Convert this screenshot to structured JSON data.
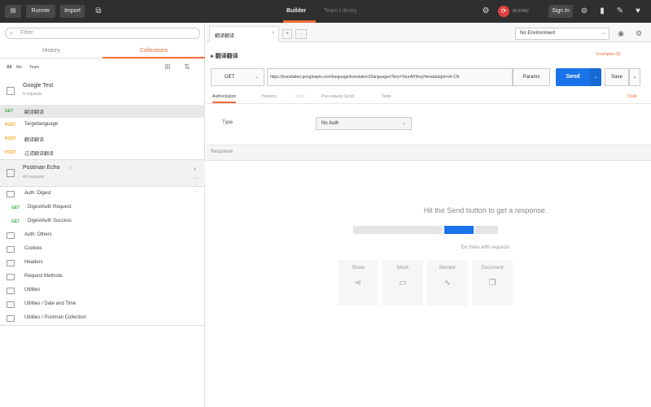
{
  "topbar": {
    "runner": "Runner",
    "import": "Import",
    "tab_builder": "Builder",
    "tab_team_library": "Team Library",
    "sync_status": "IN SYNC",
    "sign_in": "Sign In"
  },
  "sidebar": {
    "search_placeholder": "Filter",
    "tab_history": "History",
    "tab_collections": "Collections",
    "filter_all": "All",
    "filter_me": "Me",
    "filter_team": "Team",
    "collections": [
      {
        "name": "Google Test",
        "count": "4 requests",
        "items": [
          {
            "method": "GET",
            "label": "翻译翻译"
          },
          {
            "method": "POST",
            "label": "Targetlanguage"
          },
          {
            "method": "POST",
            "label": "翻译翻译"
          },
          {
            "method": "POST",
            "label": "过滤翻译翻译"
          }
        ]
      },
      {
        "name": "Postman Echo",
        "count": "40 requests",
        "items": []
      }
    ],
    "folders": [
      {
        "label": "Auth: Digest",
        "requests": [
          {
            "method": "GET",
            "label": "DigestAuth Request"
          },
          {
            "method": "GET",
            "label": "DigestAuth Success"
          }
        ]
      },
      {
        "label": "Auth: Others"
      },
      {
        "label": "Cookies"
      },
      {
        "label": "Headers"
      },
      {
        "label": "Request Methods"
      },
      {
        "label": "Utilities"
      },
      {
        "label": "Utilities / Date and Time"
      },
      {
        "label": "Utilities / Postman Collection"
      }
    ]
  },
  "main": {
    "tab_title": "翻译翻译",
    "environment": "No Environment",
    "request_name": "翻译翻译",
    "examples": "Examples (0)",
    "method": "GET",
    "url": "https://translation.googleapis.com/language/translate/v2/languages?key=YourAPIKeyHere&target=zh-CN",
    "params": "Params",
    "send": "Send",
    "save": "Save",
    "subtabs": [
      "Authorization",
      "Headers",
      "Body",
      "Pre-request Script",
      "Tests"
    ],
    "code": "Code",
    "type_label": "Type",
    "type_value": "No Auth",
    "response_label": "Response",
    "hit_send": "Hit the Send button to get a response.",
    "do_more": "Do more with requests",
    "cards": [
      {
        "label": "Share",
        "icon": "share-icon"
      },
      {
        "label": "Mock",
        "icon": "mock-icon"
      },
      {
        "label": "Monitor",
        "icon": "monitor-icon"
      },
      {
        "label": "Document",
        "icon": "document-icon"
      }
    ]
  },
  "colors": {
    "accent": "#f26b3a",
    "send": "#1a73e8",
    "get": "#3ba94d",
    "post": "#f5a623"
  }
}
